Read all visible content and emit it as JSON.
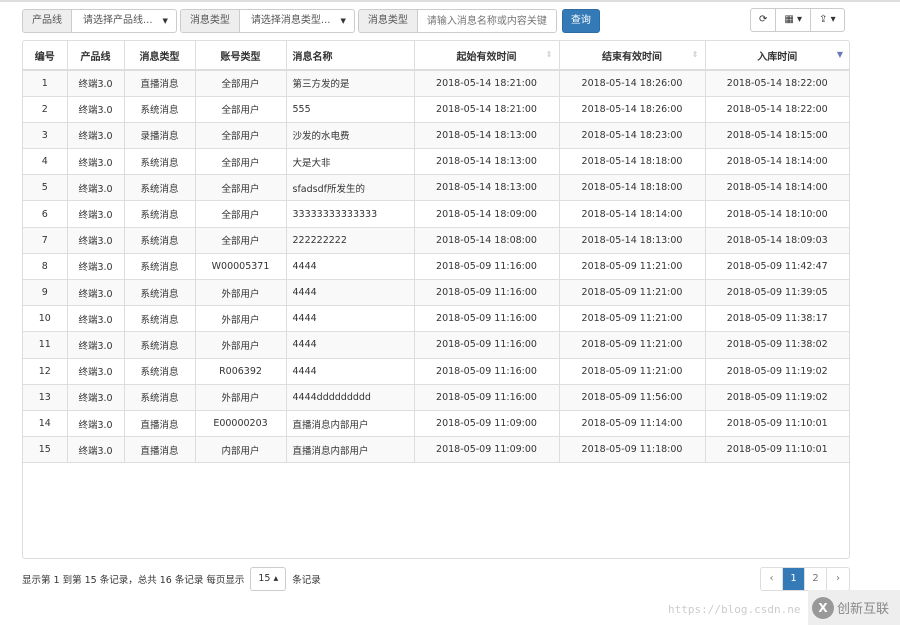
{
  "filters": {
    "product_label": "产品线",
    "product_placeholder": "请选择产品线...",
    "type_label": "消息类型",
    "type_placeholder": "请选择消息类型...",
    "keyword_label": "消息类型",
    "keyword_placeholder": "请输入消息名称或内容关键",
    "search_button": "查询"
  },
  "tools": {
    "refresh": "⟳",
    "columns": "▦ ▾",
    "export": "⇪ ▾"
  },
  "columns": [
    "编号",
    "产品线",
    "消息类型",
    "账号类型",
    "消息名称",
    "起始有效时间",
    "结束有效时间",
    "入库时间"
  ],
  "rows": [
    [
      "1",
      "终端3.0",
      "直播消息",
      "全部用户",
      "第三方发的是",
      "2018-05-14 18:21:00",
      "2018-05-14 18:26:00",
      "2018-05-14 18:22:00"
    ],
    [
      "2",
      "终端3.0",
      "系统消息",
      "全部用户",
      "555",
      "2018-05-14 18:21:00",
      "2018-05-14 18:26:00",
      "2018-05-14 18:22:00"
    ],
    [
      "3",
      "终端3.0",
      "录播消息",
      "全部用户",
      "沙发的水电费",
      "2018-05-14 18:13:00",
      "2018-05-14 18:23:00",
      "2018-05-14 18:15:00"
    ],
    [
      "4",
      "终端3.0",
      "系统消息",
      "全部用户",
      "大是大非",
      "2018-05-14 18:13:00",
      "2018-05-14 18:18:00",
      "2018-05-14 18:14:00"
    ],
    [
      "5",
      "终端3.0",
      "系统消息",
      "全部用户",
      "sfadsdf所发生的",
      "2018-05-14 18:13:00",
      "2018-05-14 18:18:00",
      "2018-05-14 18:14:00"
    ],
    [
      "6",
      "终端3.0",
      "系统消息",
      "全部用户",
      "33333333333333",
      "2018-05-14 18:09:00",
      "2018-05-14 18:14:00",
      "2018-05-14 18:10:00"
    ],
    [
      "7",
      "终端3.0",
      "系统消息",
      "全部用户",
      "222222222",
      "2018-05-14 18:08:00",
      "2018-05-14 18:13:00",
      "2018-05-14 18:09:03"
    ],
    [
      "8",
      "终端3.0",
      "系统消息",
      "W00005371",
      "4444",
      "2018-05-09 11:16:00",
      "2018-05-09 11:21:00",
      "2018-05-09 11:42:47"
    ],
    [
      "9",
      "终端3.0",
      "系统消息",
      "外部用户",
      "4444",
      "2018-05-09 11:16:00",
      "2018-05-09 11:21:00",
      "2018-05-09 11:39:05"
    ],
    [
      "10",
      "终端3.0",
      "系统消息",
      "外部用户",
      "4444",
      "2018-05-09 11:16:00",
      "2018-05-09 11:21:00",
      "2018-05-09 11:38:17"
    ],
    [
      "11",
      "终端3.0",
      "系统消息",
      "外部用户",
      "4444",
      "2018-05-09 11:16:00",
      "2018-05-09 11:21:00",
      "2018-05-09 11:38:02"
    ],
    [
      "12",
      "终端3.0",
      "系统消息",
      "R006392",
      "4444",
      "2018-05-09 11:16:00",
      "2018-05-09 11:21:00",
      "2018-05-09 11:19:02"
    ],
    [
      "13",
      "终端3.0",
      "系统消息",
      "外部用户",
      "4444ddddddddd",
      "2018-05-09 11:16:00",
      "2018-05-09 11:56:00",
      "2018-05-09 11:19:02"
    ],
    [
      "14",
      "终端3.0",
      "直播消息",
      "E00000203",
      "直播消息内部用户",
      "2018-05-09 11:09:00",
      "2018-05-09 11:14:00",
      "2018-05-09 11:10:01"
    ],
    [
      "15",
      "终端3.0",
      "直播消息",
      "内部用户",
      "直播消息内部用户",
      "2018-05-09 11:09:00",
      "2018-05-09 11:18:00",
      "2018-05-09 11:10:01"
    ]
  ],
  "footer": {
    "summary": "显示第 1 到第 15 条记录，总共 16 条记录 每页显示",
    "page_size": "15 ▴",
    "suffix": "条记录"
  },
  "pager": {
    "prev": "‹",
    "pages": [
      "1",
      "2"
    ],
    "next": "›",
    "current": "1"
  },
  "watermark": {
    "url": "https://blog.csdn.ne",
    "brand": "创新互联",
    "logo": "X"
  }
}
